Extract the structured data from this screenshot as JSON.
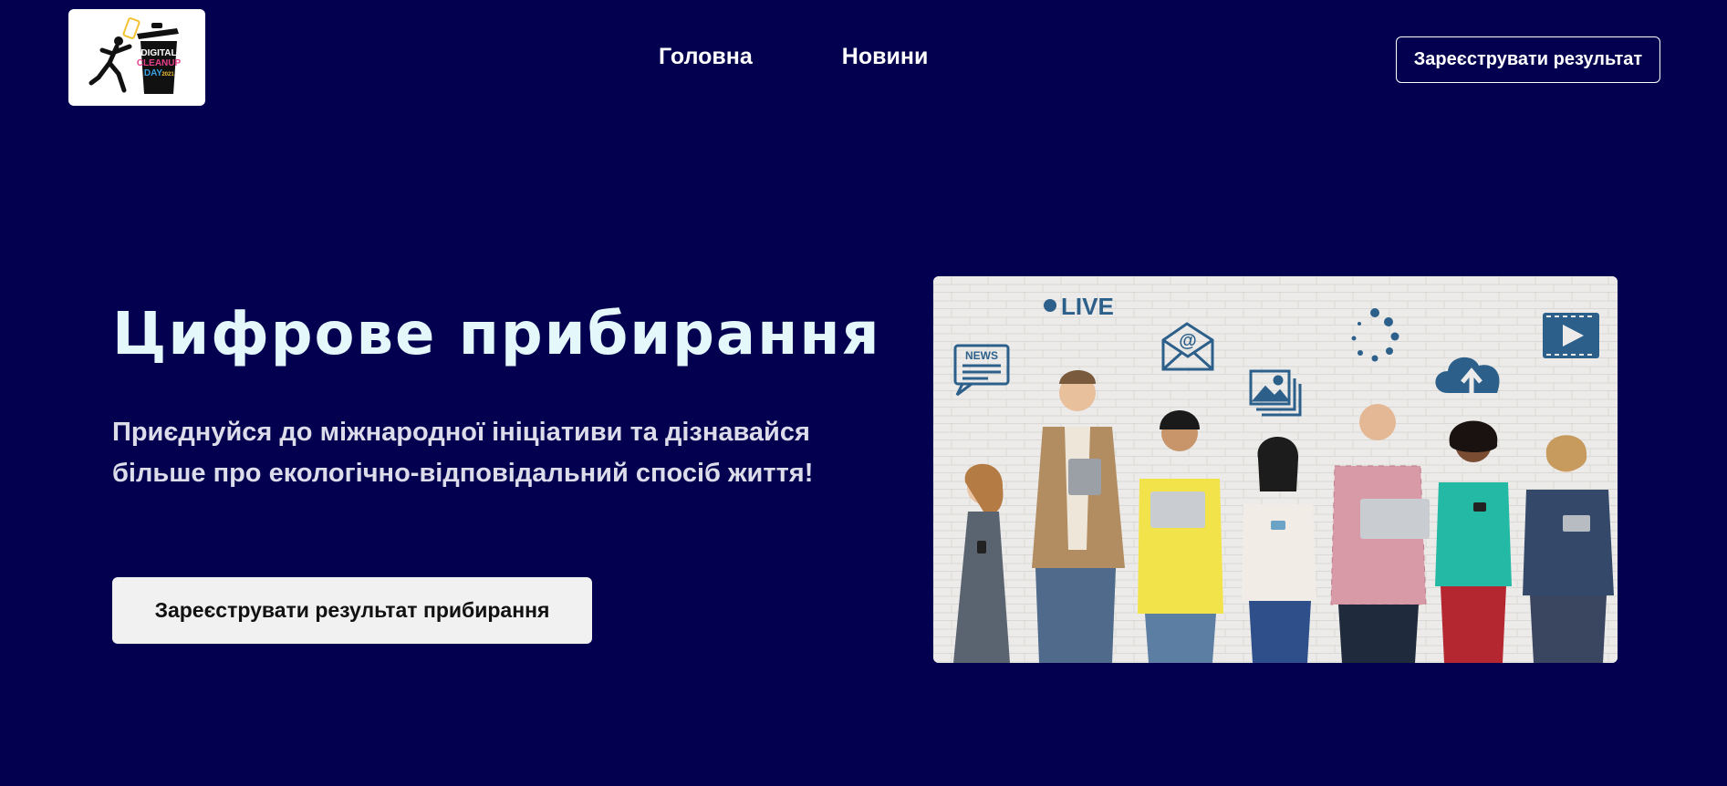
{
  "header": {
    "logo": {
      "lines": [
        "DIGITAL",
        "CLEANUP",
        "DAY"
      ],
      "year": "2021",
      "icon": "trash-can-runner-logo"
    },
    "nav": [
      {
        "label": "Головна"
      },
      {
        "label": "Новини"
      }
    ],
    "register_button": "Зареєструвати результат"
  },
  "hero": {
    "title": "Цифрове прибирання",
    "subtitle": "Приєднуйся до міжнародної ініціативи та дізнавайся більше про екологічно-відповідальний спосіб життя!",
    "cta_button": "Зареєструвати результат прибирання",
    "image": {
      "live_label": "LIVE",
      "news_label": "NEWS",
      "icons": [
        "news-icon",
        "live-icon",
        "email-icon",
        "gallery-icon",
        "loading-icon",
        "cloud-upload-icon",
        "video-icon"
      ]
    }
  },
  "colors": {
    "background": "#03014f",
    "title": "#e4f8fb",
    "accent_blue": "#2c5f8a"
  }
}
